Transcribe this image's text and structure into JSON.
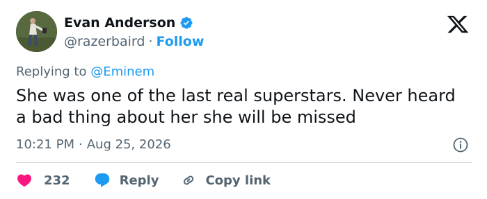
{
  "author": {
    "name": "Evan Anderson",
    "handle": "@razerbaird",
    "separator": "·",
    "follow_label": "Follow"
  },
  "reply_context": {
    "prefix": "Replying to ",
    "mention": "@Eminem"
  },
  "tweet": {
    "text": "She was one of the last real superstars. Never heard a bad thing about her she will be missed",
    "time": "10:21 PM",
    "separator": "·",
    "date": "Aug 25, 2026"
  },
  "actions": {
    "like_count": "232",
    "reply_label": "Reply",
    "copy_label": "Copy link"
  },
  "colors": {
    "accent": "#1d9bf0",
    "like": "#f91880",
    "text": "#0f1419",
    "muted": "#536471"
  },
  "icons": [
    "verified-badge-icon",
    "x-logo-icon",
    "info-icon",
    "heart-icon",
    "reply-bubble-icon",
    "link-icon"
  ]
}
